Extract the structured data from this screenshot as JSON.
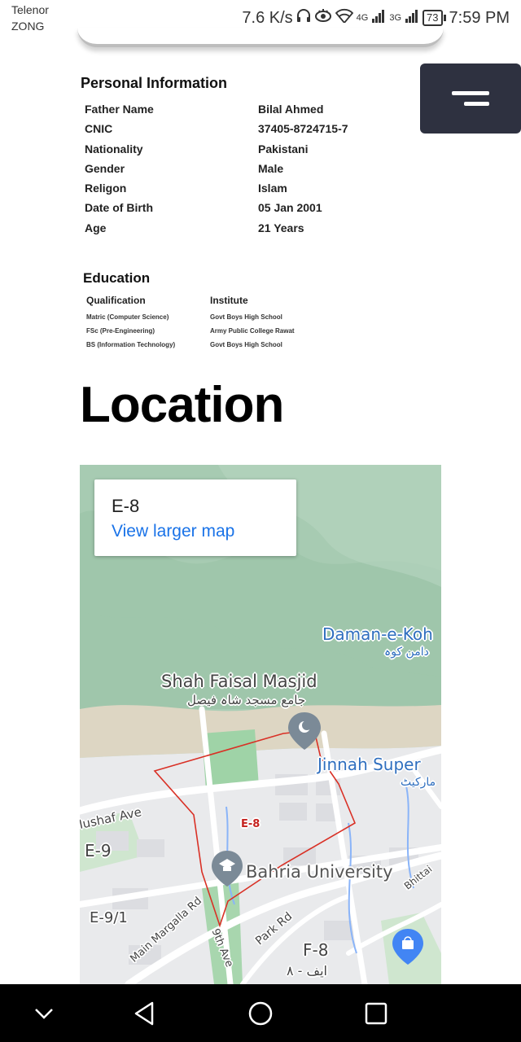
{
  "status_bar": {
    "carrier_1": "Telenor",
    "carrier_2": "ZONG",
    "net_speed": "7.6 K/s",
    "net_4g": "4G",
    "net_3g": "3G",
    "battery": "73",
    "time": "7:59 PM",
    "icons": [
      "headphones-icon",
      "eye-icon",
      "wifi-icon",
      "signal-icon",
      "signal-icon",
      "battery-icon"
    ]
  },
  "menu": {
    "icon": "hamburger-icon"
  },
  "personal": {
    "title": "Personal Information",
    "rows": [
      {
        "key": "Father Name",
        "value": "Bilal Ahmed"
      },
      {
        "key": "CNIC",
        "value": "37405-8724715-7"
      },
      {
        "key": "Nationality",
        "value": "Pakistani"
      },
      {
        "key": "Gender",
        "value": "Male"
      },
      {
        "key": "Religon",
        "value": "Islam"
      },
      {
        "key": "Date of Birth",
        "value": "05 Jan 2001"
      },
      {
        "key": "Age",
        "value": "21 Years"
      }
    ]
  },
  "education": {
    "title": "Education",
    "headers": {
      "qualification": "Qualification",
      "institute": "Institute"
    },
    "rows": [
      {
        "qualification": "Matric (Computer Science)",
        "institute": "Govt Boys High School"
      },
      {
        "qualification": "FSc (Pre-Engineering)",
        "institute": "Army Public College Rawat"
      },
      {
        "qualification": "BS (Information Technology)",
        "institute": "Govt Boys High School"
      }
    ]
  },
  "location": {
    "heading": "Location",
    "map": {
      "place_name": "E-8",
      "larger_map_link": "View larger map",
      "labels": {
        "daman_e_koh": "Daman-e-Koh",
        "daman_e_koh_urdu": "دامن کوہ",
        "shah_faisal": "Shah Faisal Masjid",
        "shah_faisal_urdu": "جامع مسجد شاہ فیصل",
        "jinnah_super": "Jinnah Super",
        "jinnah_super_urdu": "مارکیٹ",
        "mushaf_ave": "Mushaf Ave",
        "e9": "E-9",
        "e8_area": "E-8",
        "bahria": "Bahria University",
        "bhittai": "Bhittai",
        "e9_1": "E-9/1",
        "main_margalla": "Main Margalla Rd",
        "ninth_ave": "9th Ave",
        "park_rd": "Park Rd",
        "f8": "F-8",
        "f8_urdu": "ایف - ۸"
      },
      "colors": {
        "boundary": "#d93025",
        "marker": "#7b8a97",
        "shopping_marker": "#4285f4",
        "water": "#8ab4f8"
      }
    }
  },
  "nav_bar": {
    "buttons": [
      "chevron-down-icon",
      "back-icon",
      "home-icon",
      "recents-icon"
    ]
  }
}
